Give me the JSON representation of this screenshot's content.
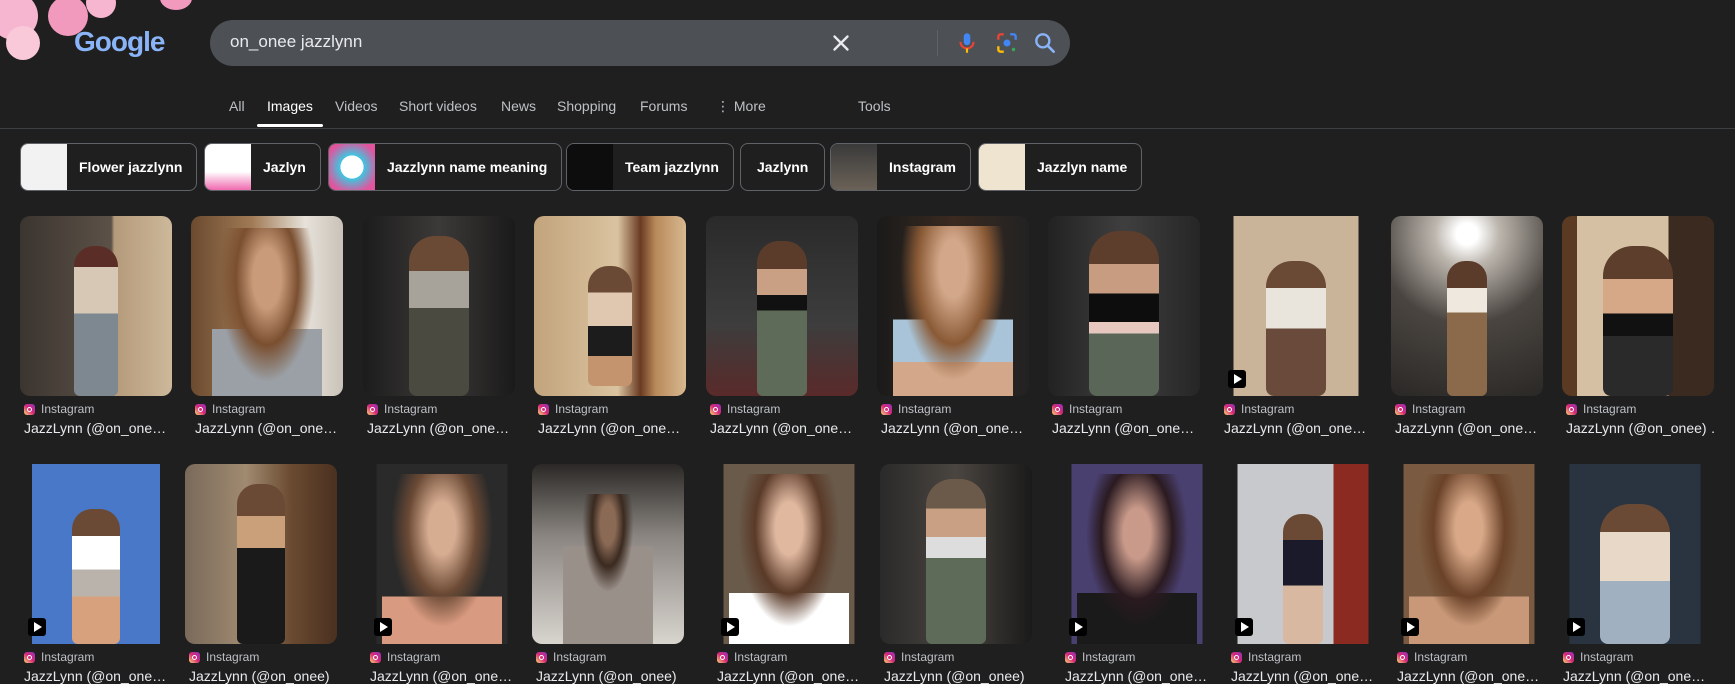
{
  "search": {
    "query": "on_onee jazzlynn"
  },
  "logo": "Google",
  "tabs": [
    "All",
    "Images",
    "Videos",
    "Short videos",
    "News",
    "Shopping",
    "Forums",
    "More",
    "Tools"
  ],
  "chips": [
    "Flower jazzlynn",
    "Jazlyn",
    "Jazzlynn name meaning",
    "Team jazzlynn",
    "Jazlynn",
    "Instagram",
    "Jazzlyn name"
  ],
  "results_row1": [
    {
      "source": "Instagram",
      "title": "JazzLynn (@on_one…"
    },
    {
      "source": "Instagram",
      "title": "JazzLynn (@on_one…"
    },
    {
      "source": "Instagram",
      "title": "JazzLynn (@on_one…"
    },
    {
      "source": "Instagram",
      "title": "JazzLynn (@on_one…"
    },
    {
      "source": "Instagram",
      "title": "JazzLynn (@on_one…"
    },
    {
      "source": "Instagram",
      "title": "JazzLynn (@on_one…"
    },
    {
      "source": "Instagram",
      "title": "JazzLynn (@on_one…"
    },
    {
      "source": "Instagram",
      "title": "JazzLynn (@on_one…"
    },
    {
      "source": "Instagram",
      "title": "JazzLynn (@on_one…"
    },
    {
      "source": "Instagram",
      "title": "JazzLynn (@on_onee) …"
    }
  ],
  "results_row2": [
    {
      "source": "Instagram",
      "title": "JazzLynn (@on_one…"
    },
    {
      "source": "Instagram",
      "title": "JazzLynn (@on_onee)"
    },
    {
      "source": "Instagram",
      "title": "JazzLynn (@on_one…"
    },
    {
      "source": "Instagram",
      "title": "JazzLynn (@on_onee)"
    },
    {
      "source": "Instagram",
      "title": "JazzLynn (@on_one…"
    },
    {
      "source": "Instagram",
      "title": "JazzLynn (@on_onee)"
    },
    {
      "source": "Instagram",
      "title": "JazzLynn (@on_one…"
    },
    {
      "source": "Instagram",
      "title": "JazzLynn (@on_one…"
    },
    {
      "source": "Instagram",
      "title": "JazzLynn (@on_one…"
    },
    {
      "source": "Instagram",
      "title": "JazzLynn (@on_one…"
    }
  ],
  "icons": [
    "clear-icon",
    "microphone-icon",
    "lens-icon",
    "search-icon",
    "more-dots-icon",
    "play-icon",
    "instagram-icon"
  ]
}
